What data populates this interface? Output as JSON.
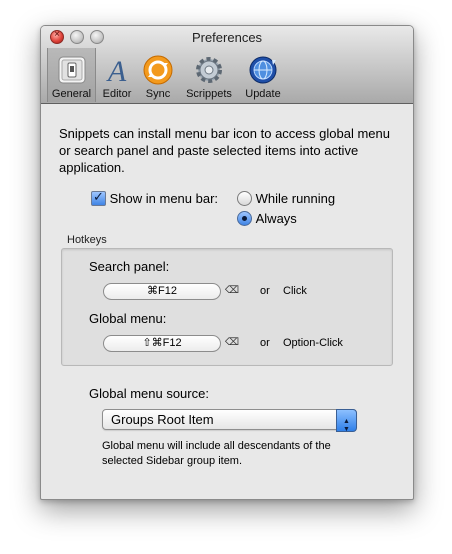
{
  "window": {
    "title": "Preferences"
  },
  "toolbar": {
    "items": [
      {
        "label": "General",
        "icon": "general-switch-icon",
        "selected": true
      },
      {
        "label": "Editor",
        "icon": "editor-letter-a-icon"
      },
      {
        "label": "Sync",
        "icon": "sync-icon"
      },
      {
        "label": "Scrippets",
        "icon": "gears-icon"
      },
      {
        "label": "Update",
        "icon": "update-globe-icon"
      }
    ]
  },
  "general": {
    "description": "Snippets can install menu bar icon to access global menu or search panel and paste selected items into active application.",
    "show_in_menu_bar": {
      "label": "Show in menu bar:",
      "checked": true
    },
    "menu_bar_mode": {
      "options": [
        "While running",
        "Always"
      ],
      "selected": "Always"
    },
    "hotkeys": {
      "group_label": "Hotkeys",
      "search_panel": {
        "label": "Search panel:",
        "value": "⌘F12",
        "or": "or",
        "alt": "Click"
      },
      "global_menu": {
        "label": "Global menu:",
        "value": "⇧⌘F12",
        "or": "or",
        "alt": "Option-Click"
      },
      "clear_glyph": "⌫"
    },
    "global_menu_source": {
      "label": "Global menu source:",
      "value": "Groups Root Item",
      "note": "Global menu will include all descendants of the selected Sidebar group item."
    }
  },
  "colors": {
    "accent": "#3f84e5",
    "close": "#e0443b"
  }
}
